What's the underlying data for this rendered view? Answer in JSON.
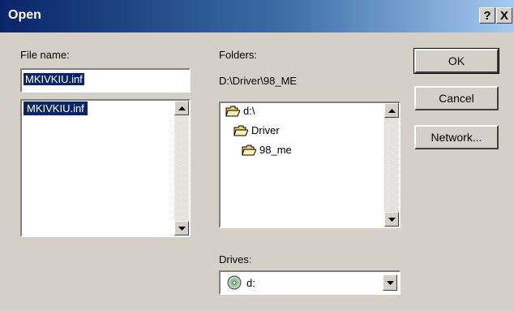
{
  "window": {
    "title": "Open",
    "help_label": "?",
    "close_label": "X"
  },
  "file_name": {
    "label": "File name:",
    "value": "MKIVKIU.inf",
    "list": [
      {
        "name": "MKIVKIU.inf",
        "selected": true
      }
    ]
  },
  "folders": {
    "label": "Folders:",
    "path": "D:\\Driver\\98_ME",
    "tree": [
      {
        "name": "d:\\",
        "level": 0,
        "icon": "open-folder-icon"
      },
      {
        "name": "Driver",
        "level": 1,
        "icon": "open-folder-icon"
      },
      {
        "name": "98_me",
        "level": 2,
        "icon": "open-folder-icon"
      }
    ]
  },
  "drives": {
    "label": "Drives:",
    "selected": "d:",
    "icon": "cd-drive-icon"
  },
  "buttons": {
    "ok": "OK",
    "cancel": "Cancel",
    "network": "Network..."
  },
  "colors": {
    "title_start": "#0a246a",
    "title_end": "#a6caf0",
    "selection": "#0a246a"
  }
}
